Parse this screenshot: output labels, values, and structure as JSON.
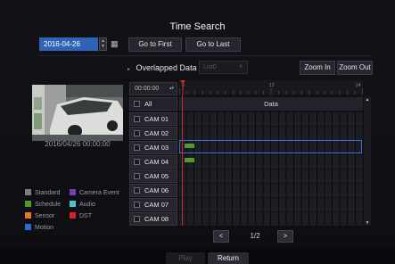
{
  "title": "Time Search",
  "date": {
    "value": "2016-04-26"
  },
  "toolbar": {
    "go_first": "Go to First",
    "go_last": "Go to Last",
    "zoom_in": "Zoom In",
    "zoom_out": "Zoom Out"
  },
  "overlapped": {
    "label": "Overlapped Data",
    "list_value": "List0"
  },
  "preview": {
    "timestamp": "2016/04/26 00:00:00"
  },
  "timeline": {
    "time_value": "00:00:00",
    "all_label": "All",
    "data_label": "Data",
    "ruler_labels": [
      "0",
      "12",
      "24"
    ],
    "cameras": [
      "CAM 01",
      "CAM 02",
      "CAM 03",
      "CAM 04",
      "CAM 05",
      "CAM 06",
      "CAM 07",
      "CAM 08"
    ],
    "selected_camera": "CAM 03"
  },
  "legend": [
    {
      "label": "Standard",
      "color": "#7d7d80"
    },
    {
      "label": "Camera Event",
      "color": "#7a3cb0"
    },
    {
      "label": "Schedule",
      "color": "#4f9a2c"
    },
    {
      "label": "Audio",
      "color": "#4fc4c4"
    },
    {
      "label": "Sensor",
      "color": "#e07a2a"
    },
    {
      "label": "DST",
      "color": "#d0242a"
    },
    {
      "label": "Motion",
      "color": "#2d6ad6"
    }
  ],
  "pagination": {
    "page": "1/2",
    "prev_icon": "chevron-left-icon",
    "next_icon": "chevron-right-icon"
  },
  "bottom": {
    "play": "Play",
    "return": "Return"
  },
  "colors": {
    "accent": "#2f63b8",
    "record_bar": "#4f9a2c",
    "playhead": "#e0242a",
    "selection": "#3a6fd8"
  }
}
